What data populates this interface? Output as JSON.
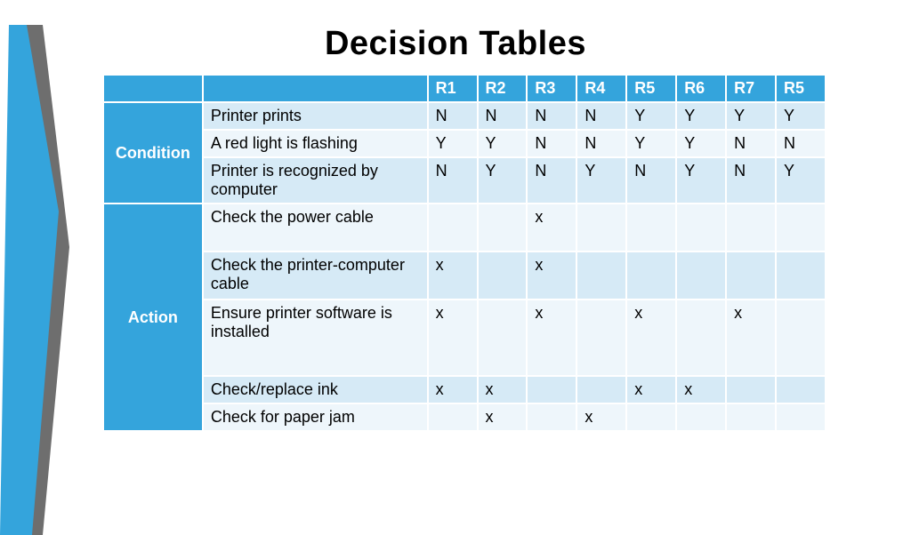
{
  "title": "Decision Tables",
  "header": {
    "rules": [
      "R1",
      "R2",
      "R3",
      "R4",
      "R5",
      "R6",
      "R7",
      "R5"
    ]
  },
  "sections": {
    "condition_label": "Condition",
    "action_label": "Action"
  },
  "conditions": [
    {
      "label": "Printer prints",
      "cells": [
        "N",
        "N",
        "N",
        "N",
        "Y",
        "Y",
        "Y",
        "Y"
      ]
    },
    {
      "label": "A red light is flashing",
      "cells": [
        "Y",
        "Y",
        "N",
        "N",
        "Y",
        "Y",
        "N",
        "N"
      ]
    },
    {
      "label": "Printer is recognized by computer",
      "cells": [
        "N",
        "Y",
        "N",
        "Y",
        "N",
        "Y",
        "N",
        "Y"
      ]
    }
  ],
  "actions": [
    {
      "label": "Check the power cable",
      "cells": [
        "",
        "",
        "x",
        "",
        "",
        "",
        "",
        ""
      ]
    },
    {
      "label": "Check the printer-computer cable",
      "cells": [
        "x",
        "",
        "x",
        "",
        "",
        "",
        "",
        ""
      ]
    },
    {
      "label": "Ensure printer software is installed",
      "cells": [
        "x",
        "",
        "x",
        "",
        "x",
        "",
        "x",
        ""
      ]
    },
    {
      "label": "Check/replace ink",
      "cells": [
        "x",
        "x",
        "",
        "",
        "x",
        "x",
        "",
        ""
      ]
    },
    {
      "label": "Check for paper jam",
      "cells": [
        "",
        "x",
        "",
        "x",
        "",
        "",
        "",
        ""
      ]
    }
  ]
}
